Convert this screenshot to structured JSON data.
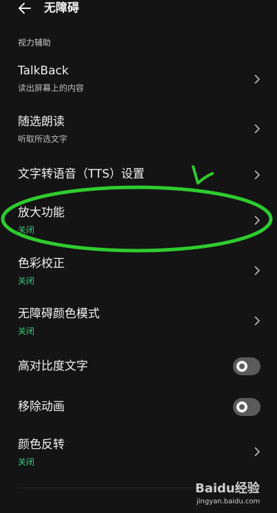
{
  "header": {
    "title": "无障碍",
    "back_icon": "back-arrow-icon"
  },
  "section": {
    "label": "视力辅助"
  },
  "items": [
    {
      "label": "TalkBack",
      "sub": "读出屏幕上的内容",
      "control": "chevron"
    },
    {
      "label": "随选朗读",
      "sub": "听取所选文字",
      "control": "chevron"
    },
    {
      "label": "文字转语音（TTS）设置",
      "sub": "",
      "control": "chevron"
    },
    {
      "label": "放大功能",
      "sub": "关闭",
      "sub_color": "#35d07f",
      "control": "chevron"
    },
    {
      "label": "色彩校正",
      "sub": "关闭",
      "sub_color": "#35d07f",
      "control": "chevron"
    },
    {
      "label": "无障碍颜色模式",
      "sub": "关闭",
      "sub_color": "#35d07f",
      "control": "chevron"
    },
    {
      "label": "高对比度文字",
      "sub": "",
      "control": "toggle",
      "state": "off"
    },
    {
      "label": "移除动画",
      "sub": "",
      "control": "toggle",
      "state": "off"
    },
    {
      "label": "颜色反转",
      "sub": "关闭",
      "sub_color": "#35d07f",
      "control": "chevron"
    }
  ],
  "annotation": {
    "ellipse_color": "#2ecc2e",
    "checkmark_color": "#2ecc2e"
  },
  "watermark": {
    "brand": "Baidu经验",
    "url": "jingyan.baidu.com"
  }
}
